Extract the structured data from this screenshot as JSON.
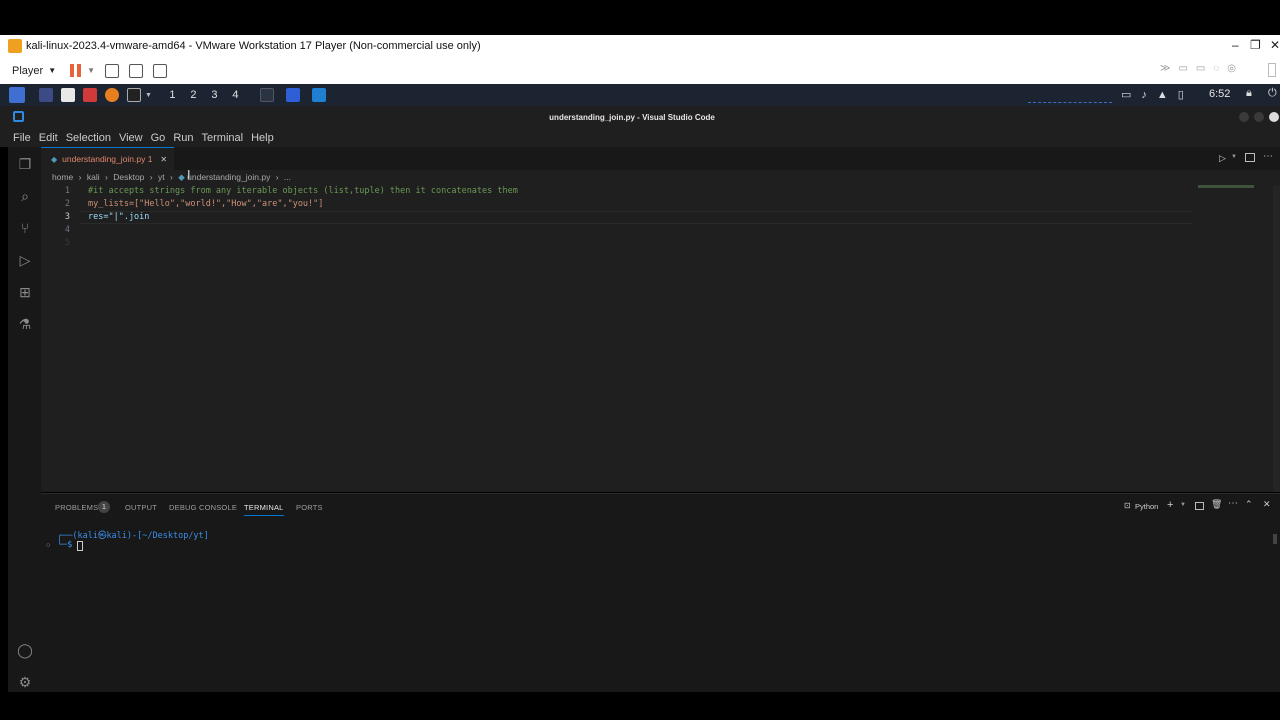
{
  "vmware": {
    "title": "kali-linux-2023.4-vmware-amd64 - VMware Workstation 17 Player (Non-commercial use only)",
    "player_menu": "Player",
    "window_controls": [
      "–",
      "❐",
      "✕"
    ]
  },
  "kali_panel": {
    "workspaces": [
      "1",
      "2",
      "3",
      "4"
    ],
    "clock": "6:52"
  },
  "vscode": {
    "window_title": "understanding_join.py - Visual Studio Code",
    "menu": [
      "File",
      "Edit",
      "Selection",
      "View",
      "Go",
      "Run",
      "Terminal",
      "Help"
    ],
    "tab": {
      "label": "understanding_join.py 1",
      "close": "✕"
    },
    "breadcrumb": [
      "home",
      "kali",
      "Desktop",
      "yt",
      "understanding_join.py",
      "..."
    ],
    "code_lines": [
      {
        "num": "1",
        "text": "#it accepts strings from any iterable objects (list,tuple) then it concatenates them"
      },
      {
        "num": "2",
        "text": "my_lists=[\"Hello\",\"world!\",\"How\",\"are\",\"you!\"]"
      },
      {
        "num": "3",
        "text": "res=\"|\".join"
      },
      {
        "num": "4",
        "text": ""
      },
      {
        "num": "5",
        "text": ""
      }
    ],
    "panel_tabs": [
      "PROBLEMS",
      "OUTPUT",
      "DEBUG CONSOLE",
      "TERMINAL",
      "PORTS"
    ],
    "problems_count": "1",
    "terminal_profile": "Python",
    "terminal": {
      "prompt_line1": "┌──(kali㉿kali)-[~/Desktop/yt]",
      "prompt_line2": "└─$ "
    }
  },
  "colors": {
    "accent": "#0078d4",
    "tab_modified": "#e2866c",
    "comment": "#6a9955",
    "string": "#ce9178",
    "variable": "#9cdcfe",
    "terminal_prompt": "#3b8eea"
  }
}
